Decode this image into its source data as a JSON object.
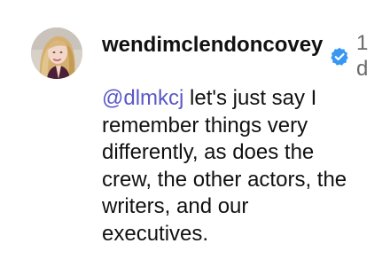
{
  "comment": {
    "username": "wendimclendoncovey",
    "time": "1d",
    "mention": "@dlmkcj",
    "text": "let's just say I remember things very differently, as does the crew, the other actors, the writers, and our executives.",
    "avatar_icon": "profile-photo",
    "verified_icon": "verified-badge-icon",
    "colors": {
      "mention": "#5a58c9",
      "verified": "#3897f0",
      "time": "#6b6b6b",
      "text": "#111111"
    }
  }
}
